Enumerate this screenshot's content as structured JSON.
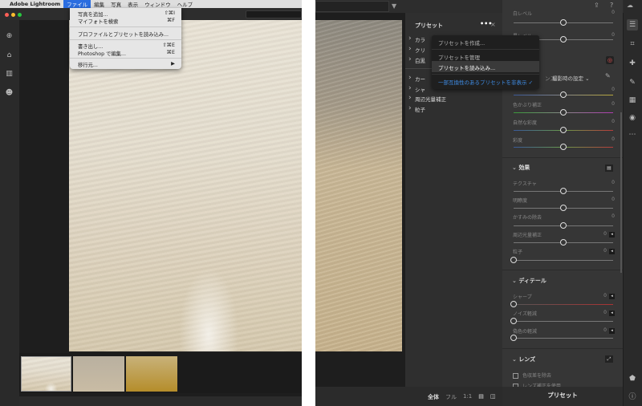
{
  "left": {
    "menubar": {
      "app": "Adobe Lightroom",
      "items": [
        "ファイル",
        "編集",
        "写真",
        "表示",
        "ウィンドウ",
        "ヘルプ"
      ],
      "active": "ファイル"
    },
    "file_menu": [
      {
        "label": "写真を追加...",
        "shortcut": "⇧⌘I"
      },
      {
        "label": "マイフォトを検索",
        "shortcut": "⌘F"
      },
      {
        "label": "プロファイルとプリセットを読み込み..."
      },
      {
        "label": "書き出し...",
        "shortcut": "⇧⌘E"
      },
      {
        "label": "Photoshop で編集...",
        "shortcut": "⌘E"
      },
      {
        "label": "移行元...",
        "shortcut": "▶"
      }
    ],
    "sidebar_icons": [
      "add-icon",
      "home-icon",
      "library-icon",
      "people-icon"
    ],
    "thumbnails": 3
  },
  "right": {
    "presets_panel": {
      "title": "プリセット",
      "items_top": [
        "カラ",
        "クリ",
        "白黒"
      ],
      "items_bottom": [
        "カー",
        "シャ",
        "周辺光量補正",
        "粒子"
      ]
    },
    "preset_menu": [
      "プリセットを作成...",
      "プリセットを管理",
      "プリセットを読み込み...",
      "一部互換性のあるプリセットを非表示"
    ],
    "preset_menu_checked": "一部互換性のあるプリセットを非表示",
    "white_balance": {
      "label": "ンス",
      "value": "撮影時の設定"
    },
    "sliders": [
      {
        "label": "白レベル",
        "value": 0,
        "range": [
          -100,
          100
        ]
      },
      {
        "label": "黒レベル",
        "value": 0,
        "range": [
          -100,
          100
        ]
      },
      {
        "label": "",
        "value": 0,
        "range": [
          -100,
          100
        ]
      },
      {
        "label": "色かぶり補正",
        "value": 0,
        "range": [
          -100,
          100
        ]
      },
      {
        "label": "自然な彩度",
        "value": 0,
        "range": [
          -100,
          100
        ]
      },
      {
        "label": "彩度",
        "value": 0,
        "range": [
          -100,
          100
        ]
      },
      {
        "label": "テクスチャ",
        "value": 0,
        "range": [
          -100,
          100
        ]
      },
      {
        "label": "明瞭度",
        "value": 0,
        "range": [
          -100,
          100
        ]
      },
      {
        "label": "かすみの除去",
        "value": 0,
        "range": [
          -100,
          100
        ]
      },
      {
        "label": "周辺光量補正",
        "value": 0,
        "range": [
          -100,
          100
        ],
        "expand": true
      },
      {
        "label": "粒子",
        "value": 0,
        "range": [
          0,
          100
        ],
        "expand": true
      },
      {
        "label": "シャープ",
        "value": 0,
        "range": [
          0,
          150
        ],
        "expand": true
      },
      {
        "label": "ノイズ軽減",
        "value": 0,
        "range": [
          0,
          100
        ],
        "expand": true
      },
      {
        "label": "偽色の軽減",
        "value": 0,
        "range": [
          0,
          100
        ],
        "expand": true
      }
    ],
    "sections": [
      "効果",
      "ディテール",
      "レンズ"
    ],
    "lens_checks": [
      "色収差を除去",
      "レンズ補正を使用"
    ],
    "bottom_presets_button": "プリセット",
    "view_modes": [
      "全体",
      "フル",
      "1:1"
    ],
    "expand_marker": "◂"
  }
}
